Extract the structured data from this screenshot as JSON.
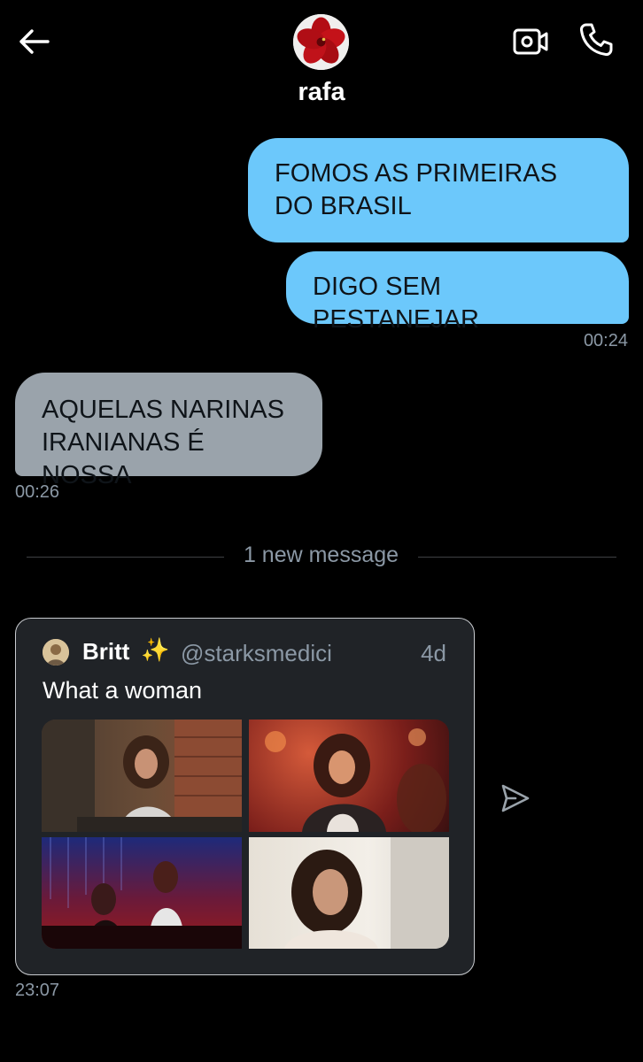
{
  "header": {
    "contact_name": "rafa"
  },
  "messages": [
    {
      "direction": "outgoing",
      "text": "FOMOS AS PRIMEIRAS DO BRASIL"
    },
    {
      "direction": "outgoing",
      "text": "DIGO SEM PESTANEJAR",
      "time": "00:24"
    },
    {
      "direction": "incoming",
      "text": "AQUELAS NARINAS IRANIANAS É NOSSA",
      "time": "00:26"
    }
  ],
  "new_message_divider": "1 new message",
  "shared_tweet": {
    "author": "Britt",
    "emoji": "✨",
    "handle": "@starksmedici",
    "age": "4d",
    "text": "What a woman",
    "photo_count": 4,
    "time": "23:07"
  },
  "icons": {
    "back": "arrow-left-icon",
    "video": "video-camera-icon",
    "call": "phone-icon",
    "share": "send-icon"
  },
  "colors": {
    "outgoing_bubble": "#6cc8fb",
    "incoming_bubble": "#9aa3ab",
    "background": "#000000",
    "muted_text": "#8b98a5"
  }
}
